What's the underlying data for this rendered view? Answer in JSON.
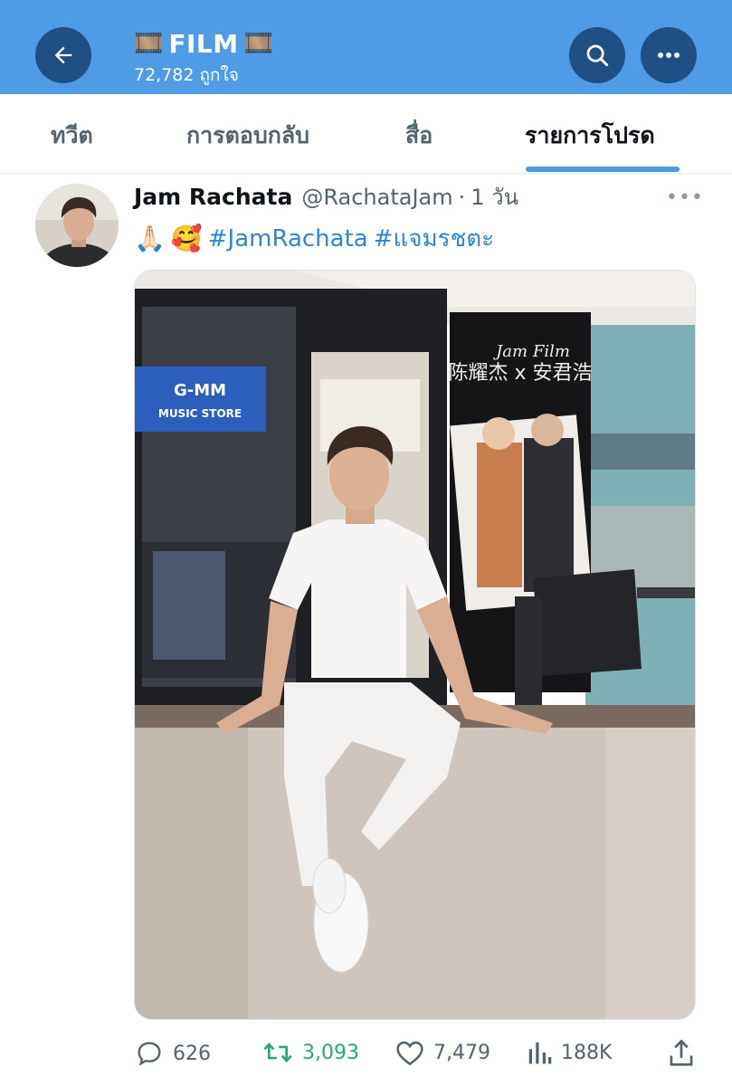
{
  "header": {
    "title": "FILM",
    "title_emoji_left": "🎞️",
    "title_emoji_right": "🎞️",
    "likes": "72,782 ถูกใจ",
    "icons": [
      "back-arrow-icon",
      "search-icon",
      "more-icon"
    ],
    "bg_color": "#4f9be6",
    "button_color": "#1f4f85"
  },
  "tabs": [
    {
      "label": "ทวีต",
      "active": false
    },
    {
      "label": "การตอบกลับ",
      "active": false
    },
    {
      "label": "สื่อ",
      "active": false
    },
    {
      "label": "รายการโปรด",
      "active": true
    }
  ],
  "tweet": {
    "author_name": "Jam Rachata",
    "handle": "@RachataJam",
    "separator": "·",
    "time": "1 วัน",
    "emojis": [
      "🙏🏻",
      "🥰"
    ],
    "hashtags": [
      "#JamRachata",
      "#แจมรชตะ"
    ],
    "photo": {
      "store_sign_brand": "G-MM",
      "store_sign_sub": "MUSIC STORE",
      "poster_text": "陈耀杰 x 安君浩",
      "poster_signature": "Jam Film"
    }
  },
  "actions": {
    "replies": "626",
    "retweets": "3,093",
    "likes": "7,479",
    "views": "188K"
  },
  "colors": {
    "accent": "#4f9be6",
    "hashtag": "#2f86d6",
    "retweet": "#2aa679",
    "muted": "#536471"
  }
}
